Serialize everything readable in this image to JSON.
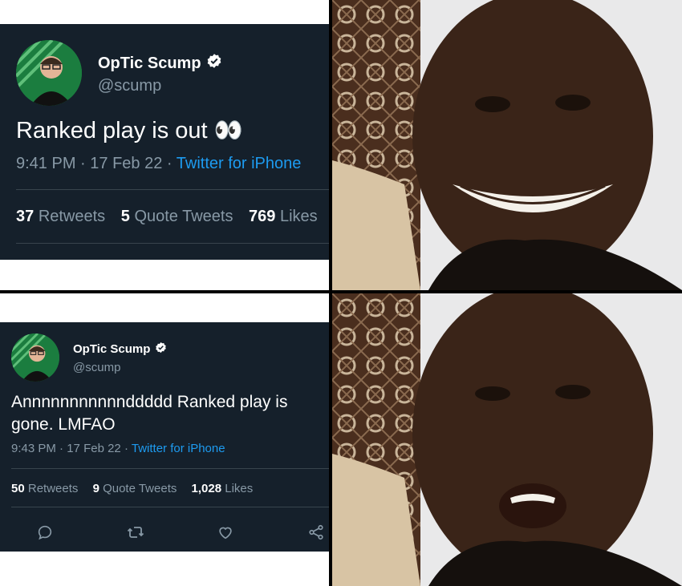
{
  "top_tweet": {
    "display_name": "OpTic Scump",
    "handle": "@scump",
    "text": "Ranked play is out 👀",
    "time": "9:41 PM",
    "date": "17 Feb 22",
    "source": "Twitter for iPhone",
    "retweets_count": "37",
    "retweets_label": "Retweets",
    "quote_count": "5",
    "quote_label": "Quote Tweets",
    "likes_count": "769",
    "likes_label": "Likes"
  },
  "bottom_tweet": {
    "display_name": "OpTic Scump",
    "handle": "@scump",
    "text": "Annnnnnnnnnnddddd Ranked play is gone. LMFAO",
    "time": "9:43 PM",
    "date": "17 Feb 22",
    "source": "Twitter for iPhone",
    "retweets_count": "50",
    "retweets_label": "Retweets",
    "quote_count": "9",
    "quote_label": "Quote Tweets",
    "likes_count": "1,028",
    "likes_label": "Likes"
  },
  "icons": {
    "verified": "verified-badge-icon",
    "reply": "reply-icon",
    "retweet": "retweet-icon",
    "like": "heart-icon",
    "share": "share-icon"
  },
  "colors": {
    "tweet_bg": "#15202b",
    "muted": "#8899a6",
    "link": "#1d9bf0",
    "verified": "#ffffff"
  }
}
